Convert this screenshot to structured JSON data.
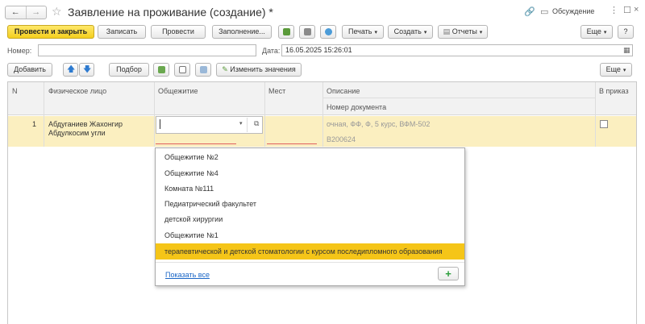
{
  "window": {
    "title": "Заявление на проживание (создание) *",
    "discuss_label": "Обсуждение"
  },
  "toolbar": {
    "post_close": "Провести и закрыть",
    "save": "Записать",
    "post": "Провести",
    "fill": "Заполнение...",
    "print": "Печать",
    "create": "Создать",
    "reports": "Отчеты",
    "more": "Еще",
    "help": "?"
  },
  "header_fields": {
    "number_label": "Номер:",
    "number_value": "",
    "date_label": "Дата:",
    "date_value": "16.05.2025 15:26:01"
  },
  "table_toolbar": {
    "add": "Добавить",
    "pick": "Подбор",
    "change_values": "Изменить значения",
    "more": "Еще"
  },
  "table": {
    "columns": {
      "n": "N",
      "person": "Физическое лицо",
      "dorm": "Общежитие",
      "places": "Мест",
      "description": "Описание",
      "doc_number": "Номер документа",
      "to_order": "В приказ"
    },
    "rows": [
      {
        "n": "1",
        "person_line1": "Абдуганиев Жахонгир",
        "person_line2": "Абдулкосим угли",
        "dorm": "",
        "places": "",
        "description": "очная, ФФ, Ф, 5 курс, ВФМ-502",
        "doc_number": "В200624",
        "to_order": false
      }
    ]
  },
  "dropdown": {
    "options": [
      "Общежитие №2",
      "Общежитие №4",
      "Комната №111",
      "Педиатрический факультет",
      "детской хирургии",
      "Общежитие №1",
      "терапевтической и детской стоматологии с курсом последипломного образования"
    ],
    "selected_index": 6,
    "show_all": "Показать все",
    "add_button": "+"
  }
}
